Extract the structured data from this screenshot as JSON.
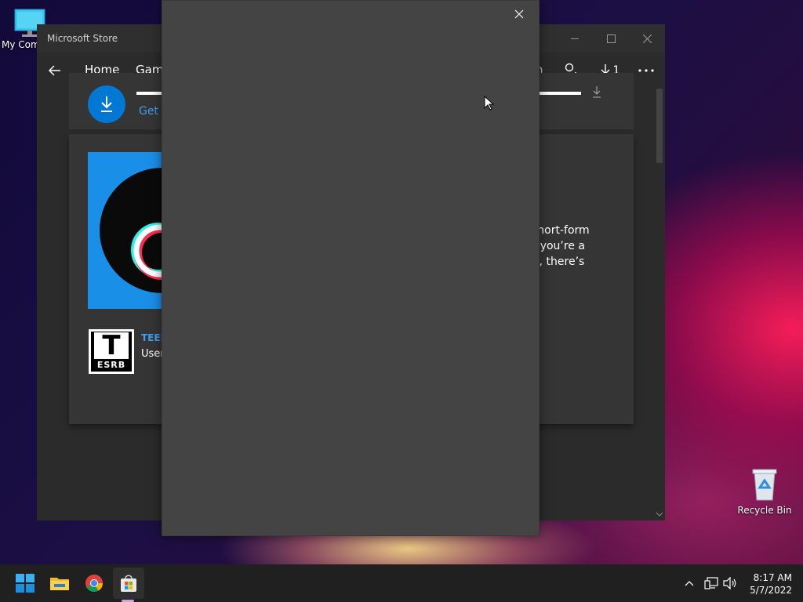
{
  "desktop": {
    "my_computer_label": "My Com",
    "recycle_bin_label": "Recycle Bin"
  },
  "store": {
    "title": "Microsoft Store",
    "nav": {
      "home": "Home",
      "gaming": "Gami",
      "partial_label": "n",
      "downloads_count": "1"
    },
    "app": {
      "get_link": "Get (",
      "description_lines": [
        "k, short-form",
        "her you’re a",
        "ugh, there’s"
      ],
      "rating_label": "TEEN",
      "rating_sub": "User",
      "esrb_letter": "T",
      "esrb_text": "ESRB"
    }
  },
  "taskbar": {
    "time": "8:17 AM",
    "date": "5/7/2022"
  },
  "colors": {
    "accent": "#0078d4",
    "tiktok_bg": "#1a8fe8"
  }
}
